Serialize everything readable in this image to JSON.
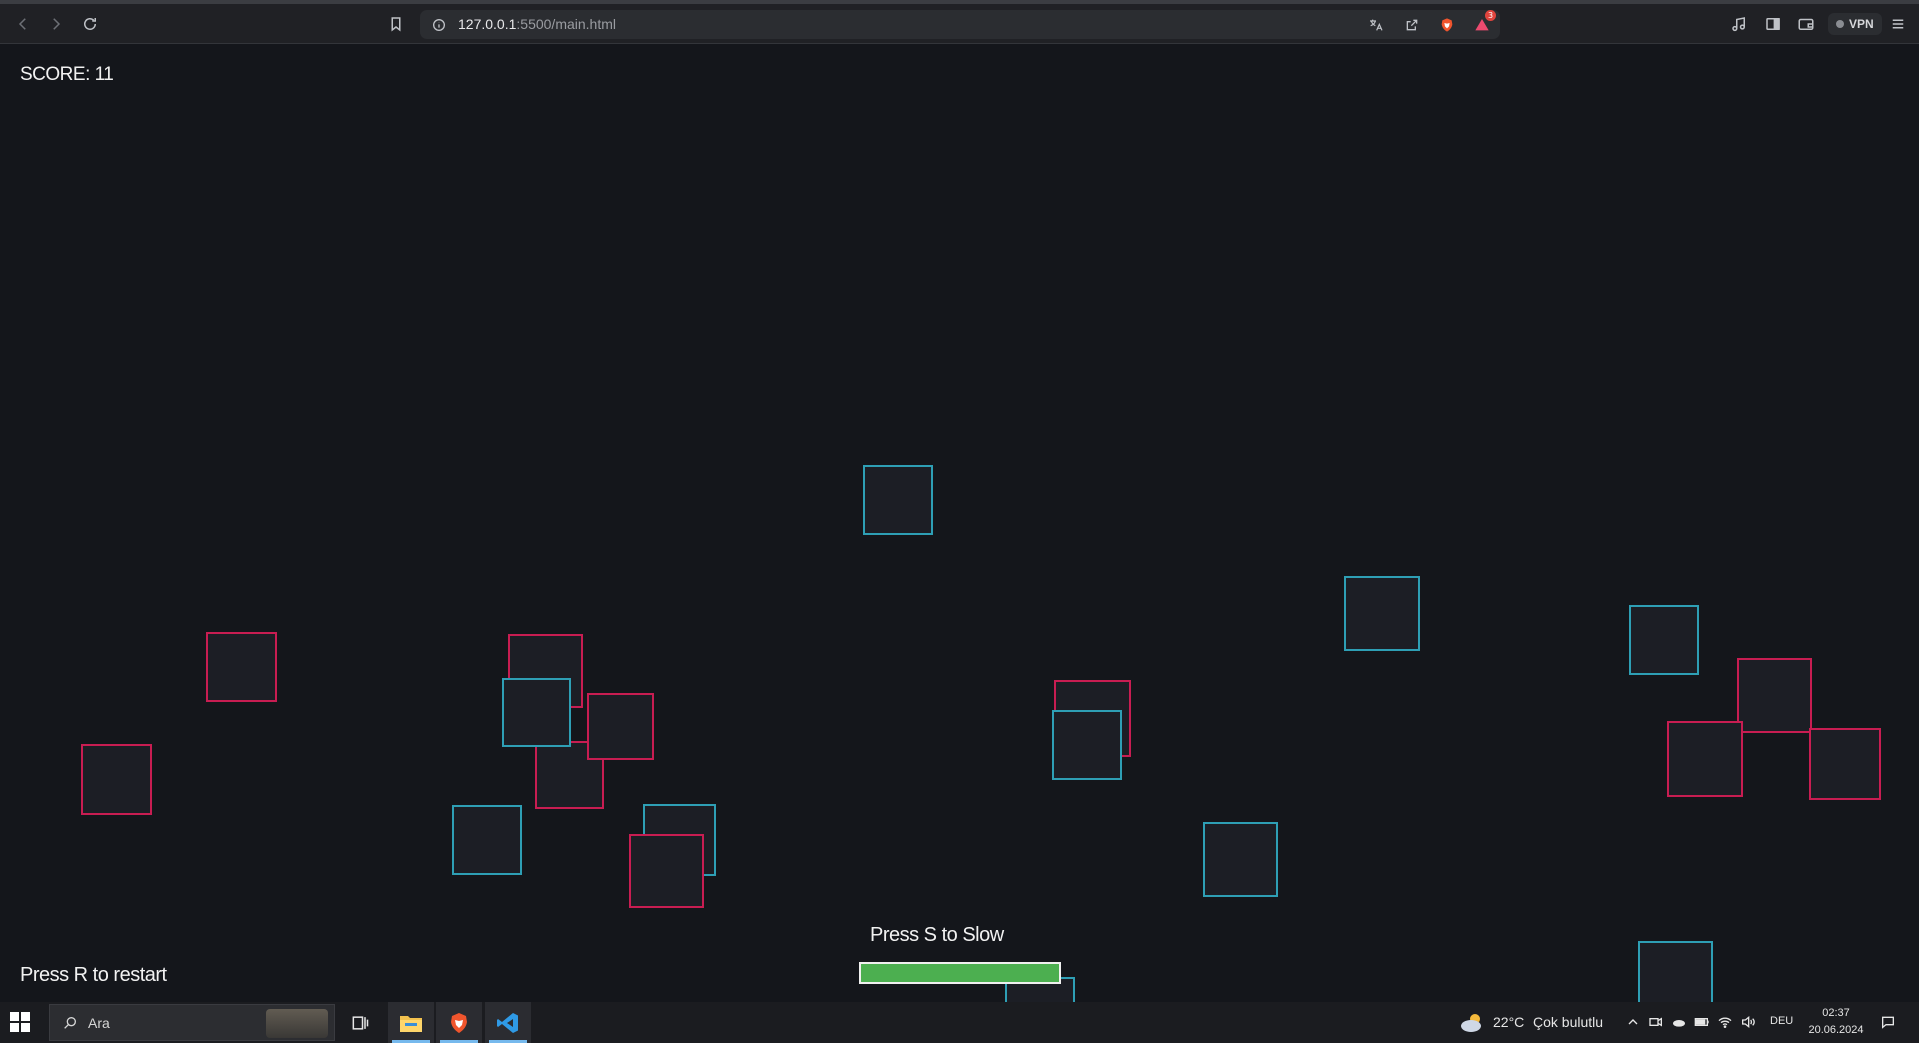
{
  "browser": {
    "url_host": "127.0.0.1",
    "url_rest": ":5500/main.html",
    "notification_count": "3",
    "vpn_label": "VPN",
    "icons": [
      "back-icon",
      "forward-icon",
      "reload-icon",
      "bookmark-icon",
      "site-info-icon",
      "translate-icon",
      "share-icon",
      "brave-shields-icon",
      "brave-rewards-icon",
      "media-icon",
      "sidebar-icon",
      "wallet-icon",
      "menu-icon"
    ]
  },
  "game": {
    "score_text": "SCORE: 11",
    "restart_text": "Press R to restart",
    "slow_text": "Press S to Slow",
    "slow_meter_fraction": 1.0,
    "colors": {
      "background": "#14161b",
      "red_box": "#c81d52",
      "cyan_box": "#2e9fb5",
      "slow_meter": "#4caf50"
    }
  },
  "taskbar": {
    "search_placeholder": "Ara",
    "weather_temp": "22°C",
    "weather_desc": "Çok bulutlu",
    "language": "DEU",
    "time": "02:37",
    "date": "20.06.2024",
    "apps": [
      "task-view",
      "file-explorer",
      "brave-browser",
      "vscode"
    ]
  }
}
